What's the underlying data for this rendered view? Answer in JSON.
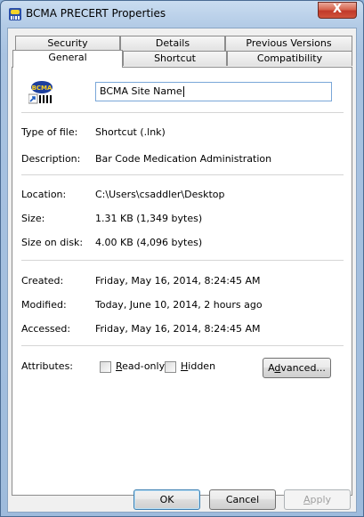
{
  "window": {
    "title": "BCMA PRECERT Properties",
    "close_label": "X"
  },
  "tabs": {
    "row1": [
      "Security",
      "Details",
      "Previous Versions"
    ],
    "row2": [
      "General",
      "Shortcut",
      "Compatibility"
    ],
    "active": "General"
  },
  "general": {
    "name_value": "BCMA Site Name",
    "icon_text": "BCMA",
    "type_label": "Type of file:",
    "type_value": "Shortcut (.lnk)",
    "description_label": "Description:",
    "description_value": "Bar Code Medication Administration",
    "location_label": "Location:",
    "location_value": "C:\\Users\\csaddler\\Desktop",
    "size_label": "Size:",
    "size_value": "1.31 KB (1,349 bytes)",
    "size_on_disk_label": "Size on disk:",
    "size_on_disk_value": "4.00 KB (4,096 bytes)",
    "created_label": "Created:",
    "created_value": "Friday, May 16, 2014, 8:24:45 AM",
    "modified_label": "Modified:",
    "modified_value": "Today, June 10, 2014, 2 hours ago",
    "accessed_label": "Accessed:",
    "accessed_value": "Friday, May 16, 2014, 8:24:45 AM",
    "attributes_label": "Attributes:",
    "readonly_first": "R",
    "readonly_rest": "ead-only",
    "hidden_first": "H",
    "hidden_rest": "idden",
    "advanced_pre": "A",
    "advanced_u": "d",
    "advanced_rest": "vanced..."
  },
  "buttons": {
    "ok": "OK",
    "cancel": "Cancel",
    "apply_first": "A",
    "apply_rest": "pply"
  }
}
